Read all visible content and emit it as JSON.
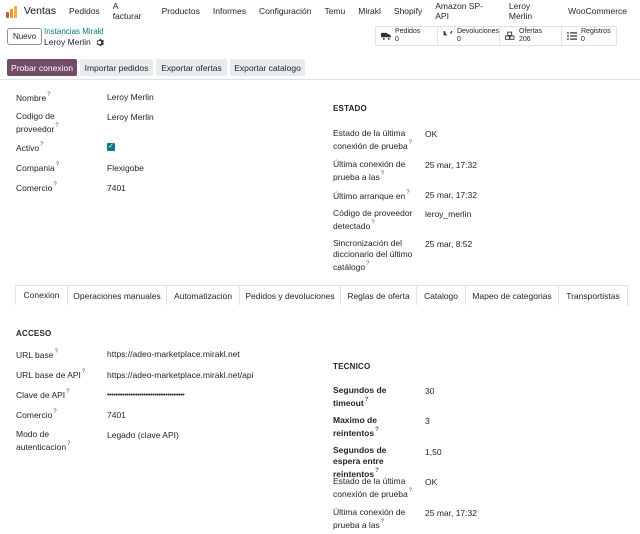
{
  "nav": {
    "app": "Ventas",
    "menu": [
      "Pedidos",
      "A facturar",
      "Productos",
      "Informes",
      "Configuración",
      "Temu",
      "Mirakl",
      "Shopify",
      "Amazon SP-API",
      "Leroy Merlin",
      "WooCommerce"
    ]
  },
  "control": {
    "new_label": "Nuevo",
    "breadcrumb_parent": "Instancias Mirakl",
    "breadcrumb_current": "Leroy Merlin"
  },
  "stats": [
    {
      "label": "Pedidos",
      "value": "0",
      "icon": "truck-icon"
    },
    {
      "label": "Devoluciones",
      "value": "0",
      "icon": "undo-icon"
    },
    {
      "label": "Ofertas",
      "value": "206",
      "icon": "cubes-icon"
    },
    {
      "label": "Registros",
      "value": "0",
      "icon": "list-icon"
    }
  ],
  "actions": [
    "Probar conexion",
    "Importar pedidos",
    "Exportar ofertas",
    "Exportar catalogo"
  ],
  "main_left": [
    {
      "label": "Nombre",
      "value": "Leroy Merlin"
    },
    {
      "label": "Codigo de proveedor",
      "value": "Leroy Merlin"
    },
    {
      "label": "Activo",
      "value": ""
    },
    {
      "label": "Compania",
      "value": "Flexigobe"
    },
    {
      "label": "Comercio",
      "value": "7401"
    }
  ],
  "estado": {
    "title": "ESTADO",
    "rows": [
      {
        "label": "Estado de la última conexión de prueba",
        "value": "OK"
      },
      {
        "label": "Última conexión de prueba a las",
        "value": "25 mar, 17:32"
      },
      {
        "label": "Último arranque en",
        "value": "25 mar, 17:32"
      },
      {
        "label": "Código de proveedor detectado",
        "value": "leroy_merlin"
      },
      {
        "label": "Sincronización del diccionario del último catálogo",
        "value": "25 mar, 8:52"
      }
    ]
  },
  "tabs": [
    "Conexion",
    "Operaciones manuales",
    "Automatizacion",
    "Pedidos y devoluciones",
    "Reglas de oferta",
    "Catalogo",
    "Mapeo de categorias",
    "Transportistas"
  ],
  "acceso": {
    "title": "ACCESO",
    "rows": [
      {
        "label": "URL base",
        "value": "https://adeo-marketplace.mirakl.net"
      },
      {
        "label": "URL base de API",
        "value": "https://adeo-marketplace.mirakl.net/api"
      },
      {
        "label": "Clave de API",
        "value": "••••••••••••••••••••••••••••••••••••"
      },
      {
        "label": "Comercio",
        "value": "7401"
      },
      {
        "label": "Modo de autenticacion",
        "value": "Legado (clave API)"
      }
    ]
  },
  "tecnico": {
    "title": "TECNICO",
    "rows": [
      {
        "label": "Segundos de timeout",
        "value": "30"
      },
      {
        "label": "Maximo de reintentos",
        "value": "3"
      },
      {
        "label": "Segundos de espera entre reintentos",
        "value": "1,50"
      },
      {
        "label": "Estado de la última conexión de prueba",
        "value": "OK"
      },
      {
        "label": "Última conexión de prueba a las",
        "value": "25 mar, 17:32"
      }
    ]
  },
  "colors": {
    "primary": "#714b67",
    "accent": "#017e84"
  }
}
